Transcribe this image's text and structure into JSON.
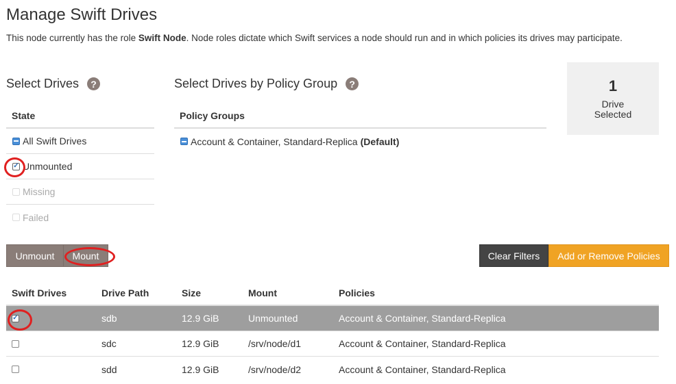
{
  "page": {
    "title": "Manage Swift Drives",
    "intro_before": "This node currently has the role ",
    "intro_role": "Swift Node",
    "intro_after": ". Node roles dictate which Swift services a node should run and in which policies its drives may participate."
  },
  "select_drives": {
    "heading": "Select Drives",
    "help_icon": "?",
    "column_header": "State",
    "items": [
      {
        "label": "All Swift Drives",
        "state": "partial"
      },
      {
        "label": "Unmounted",
        "state": "checked"
      },
      {
        "label": "Missing",
        "state": "disabled"
      },
      {
        "label": "Failed",
        "state": "disabled"
      }
    ]
  },
  "policy_group": {
    "heading": "Select Drives by Policy Group",
    "help_icon": "?",
    "column_header": "Policy Groups",
    "items": [
      {
        "label": "Account & Container, Standard-Replica",
        "suffix": "(Default)",
        "state": "partial"
      }
    ]
  },
  "selection_summary": {
    "count": "1",
    "label": "Drive Selected"
  },
  "actions": {
    "unmount_label": "Unmount",
    "mount_label": "Mount",
    "clear_filters_label": "Clear Filters",
    "policies_label": "Add or Remove Policies"
  },
  "drives_table": {
    "columns": [
      "Swift Drives",
      "Drive Path",
      "Size",
      "Mount",
      "Policies"
    ],
    "rows": [
      {
        "checked": true,
        "path": "sdb",
        "size": "12.9 GiB",
        "mount": "Unmounted",
        "policies": "Account & Container, Standard-Replica"
      },
      {
        "checked": false,
        "path": "sdc",
        "size": "12.9 GiB",
        "mount": "/srv/node/d1",
        "policies": "Account & Container, Standard-Replica"
      },
      {
        "checked": false,
        "path": "sdd",
        "size": "12.9 GiB",
        "mount": "/srv/node/d2",
        "policies": "Account & Container, Standard-Replica"
      }
    ]
  },
  "colors": {
    "brand_gray": "#8a7d78",
    "accent_orange": "#f0a324",
    "selected_row": "#9e9e9e",
    "highlight_ring": "#e02020"
  }
}
